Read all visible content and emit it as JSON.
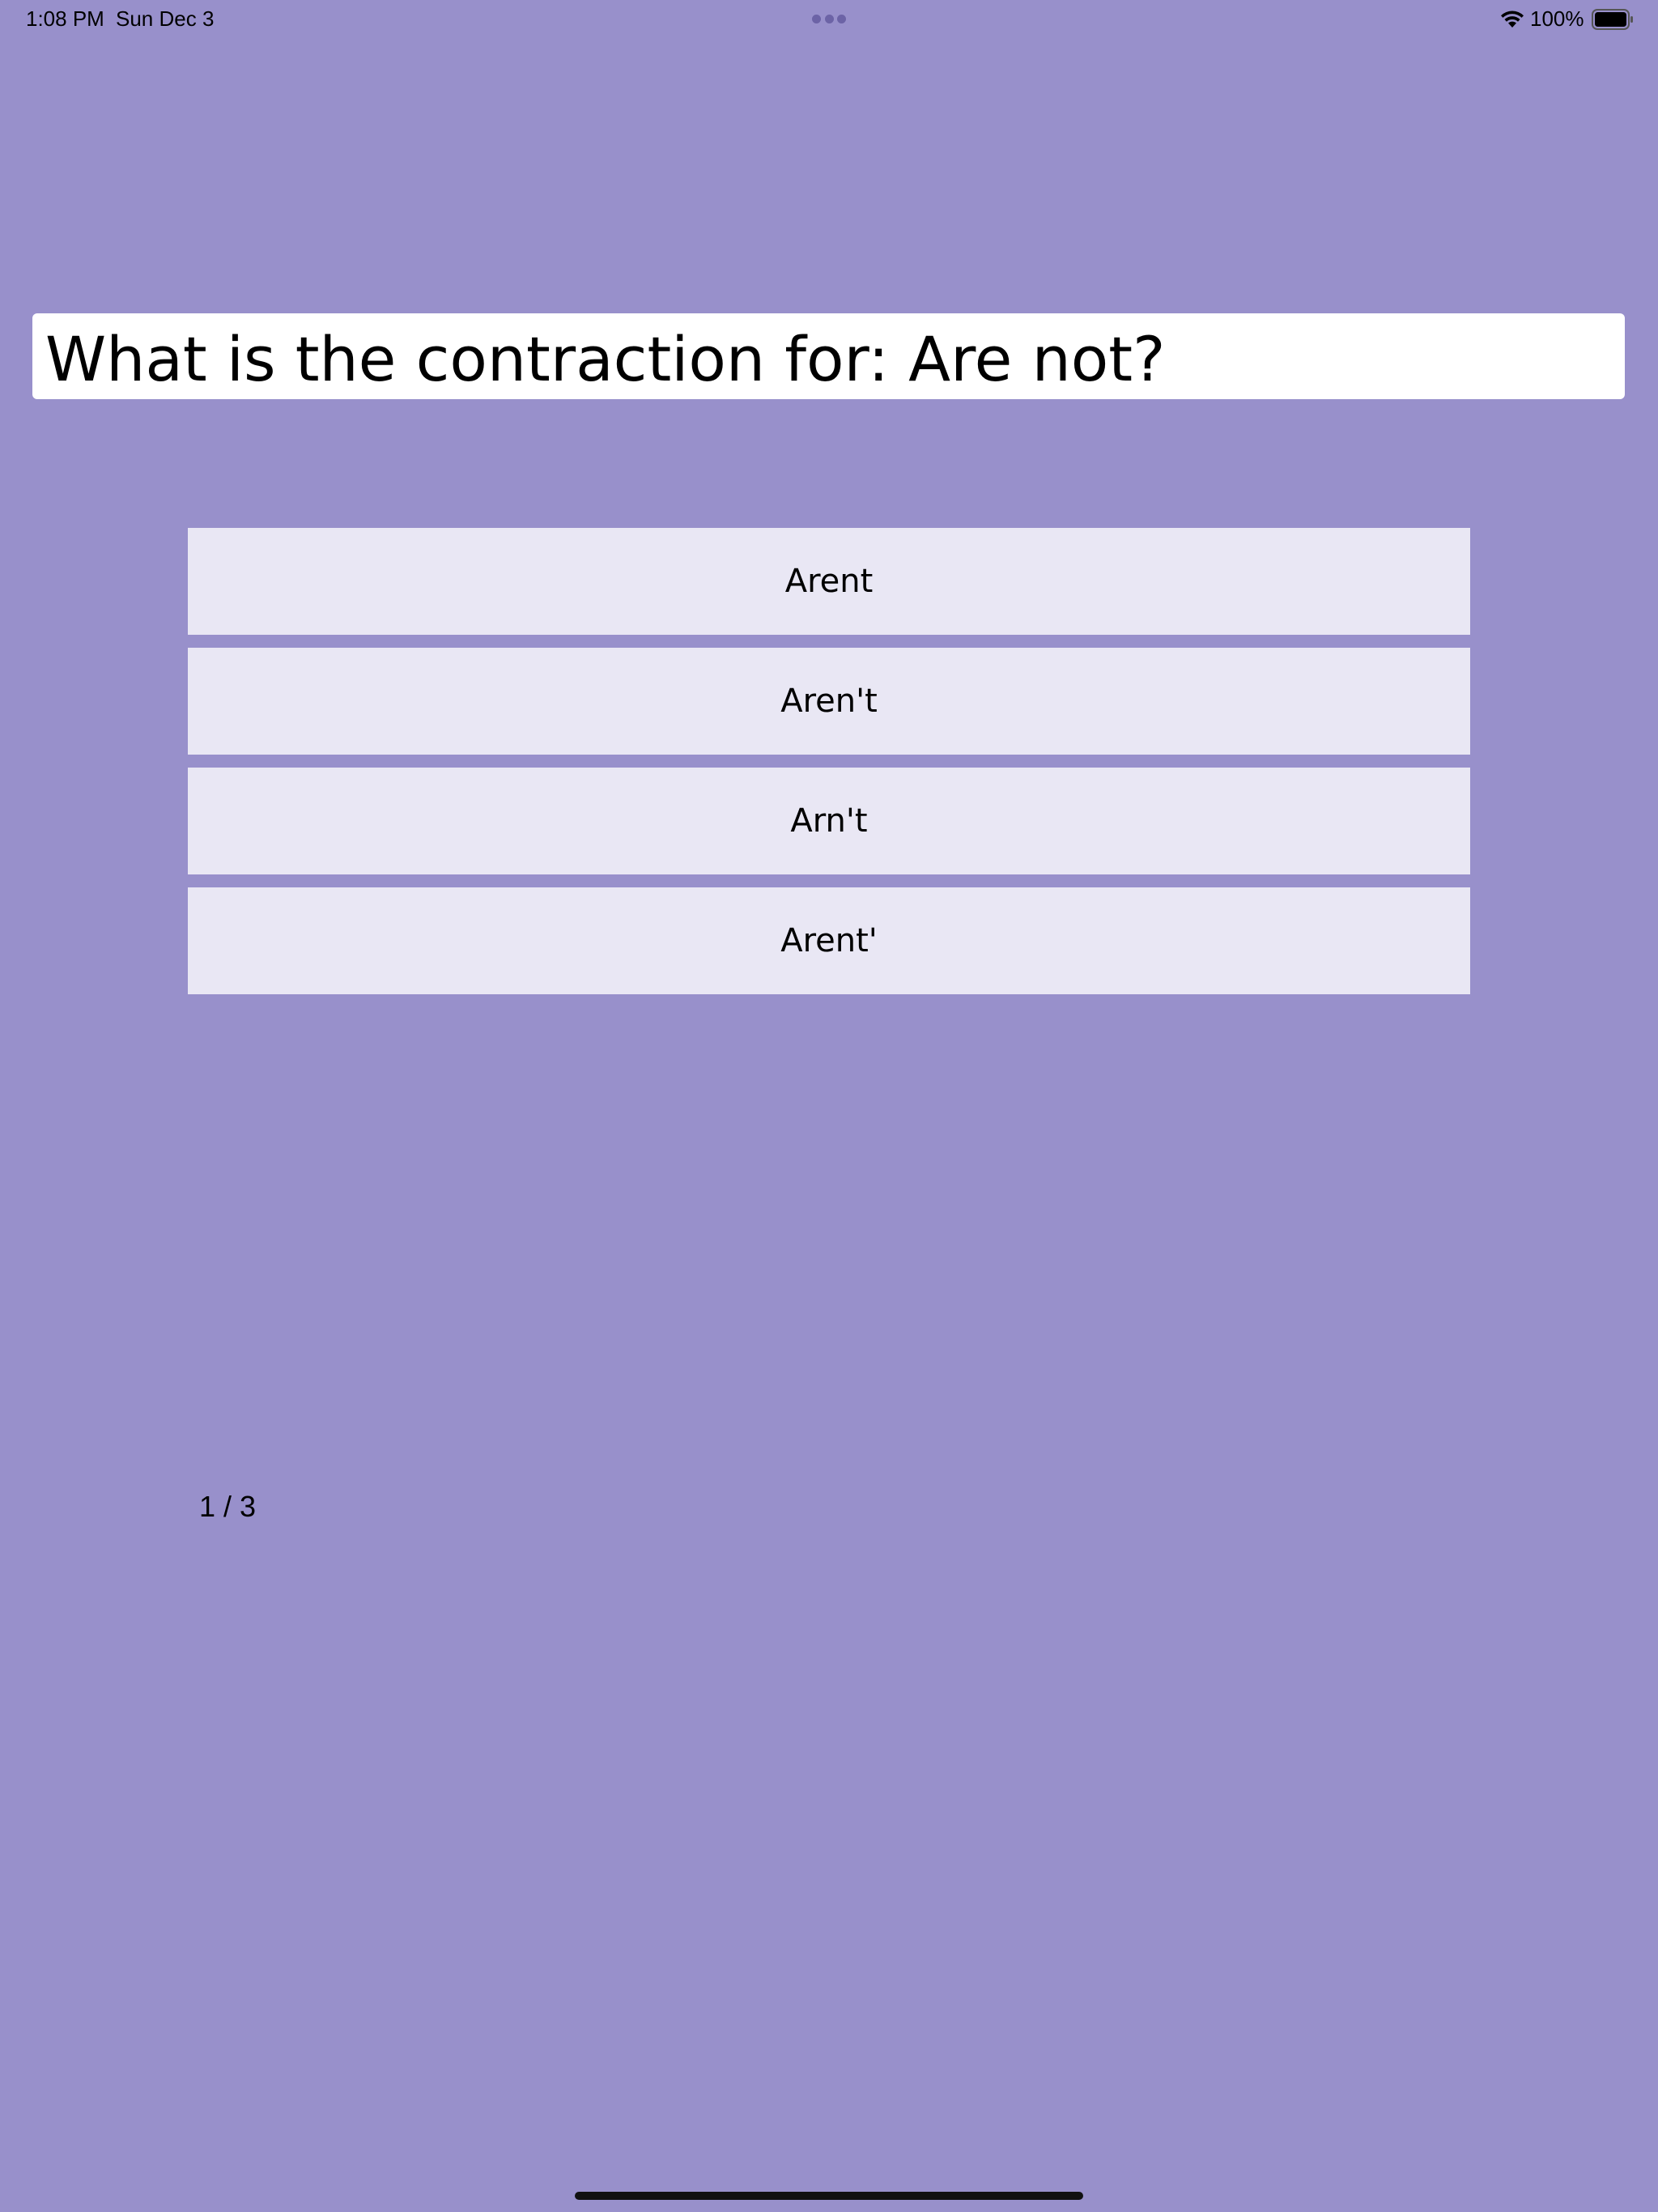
{
  "status_bar": {
    "time": "1:08 PM",
    "date": "Sun Dec 3",
    "battery_percent": "100%",
    "wifi_icon": "wifi-icon",
    "battery_icon": "battery-icon",
    "multitask_icon": "more-dots-icon"
  },
  "quiz": {
    "question": "What is the contraction for: Are not?",
    "options": [
      {
        "label": "Arent"
      },
      {
        "label": "Aren't"
      },
      {
        "label": "Arn't"
      },
      {
        "label": "Arent'"
      }
    ],
    "progress": "1 / 3"
  },
  "colors": {
    "background": "#9890cb",
    "option_background": "#e9e7f4",
    "question_background": "#ffffff"
  }
}
